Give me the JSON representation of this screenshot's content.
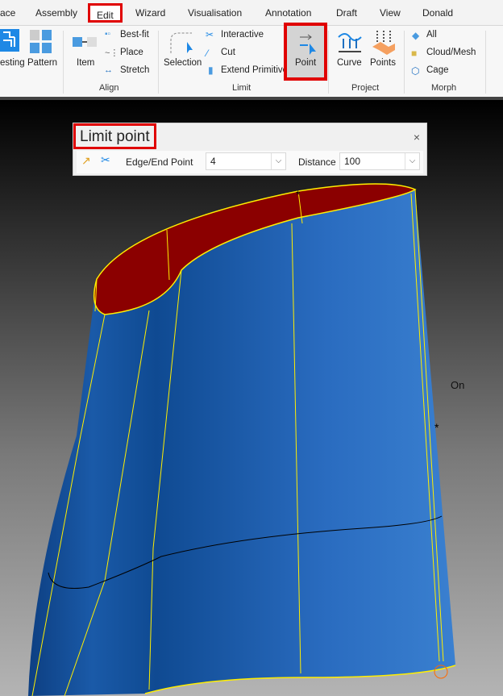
{
  "tabs": [
    "ace",
    "Assembly",
    "Edit",
    "Wizard",
    "Visualisation",
    "Annotation",
    "Draft",
    "View",
    "Donald"
  ],
  "ribbon": {
    "nesting": "esting",
    "pattern": "Pattern",
    "align": {
      "item": "Item",
      "bestfit": "Best-fit",
      "place": "Place",
      "stretch": "Stretch",
      "label": "Align"
    },
    "limit": {
      "selection": "Selection",
      "interactive": "Interactive",
      "cut": "Cut",
      "extend": "Extend Primitive",
      "point": "Point",
      "label": "Limit"
    },
    "project": {
      "curve": "Curve",
      "points": "Points",
      "label": "Project"
    },
    "morph": {
      "all": "All",
      "cloud": "Cloud/Mesh",
      "cage": "Cage",
      "label": "Morph"
    }
  },
  "dialog": {
    "title": "Limit point",
    "close": "×",
    "edge_label": "Edge/End Point",
    "edge_value": "4",
    "distance_label": "Distance",
    "distance_value": "100"
  },
  "viewport": {
    "on_label": "On"
  },
  "colors": {
    "highlight": "#e00000",
    "surface": "#1a5aa8",
    "cap": "#8b0000",
    "edge": "#ffee00"
  }
}
